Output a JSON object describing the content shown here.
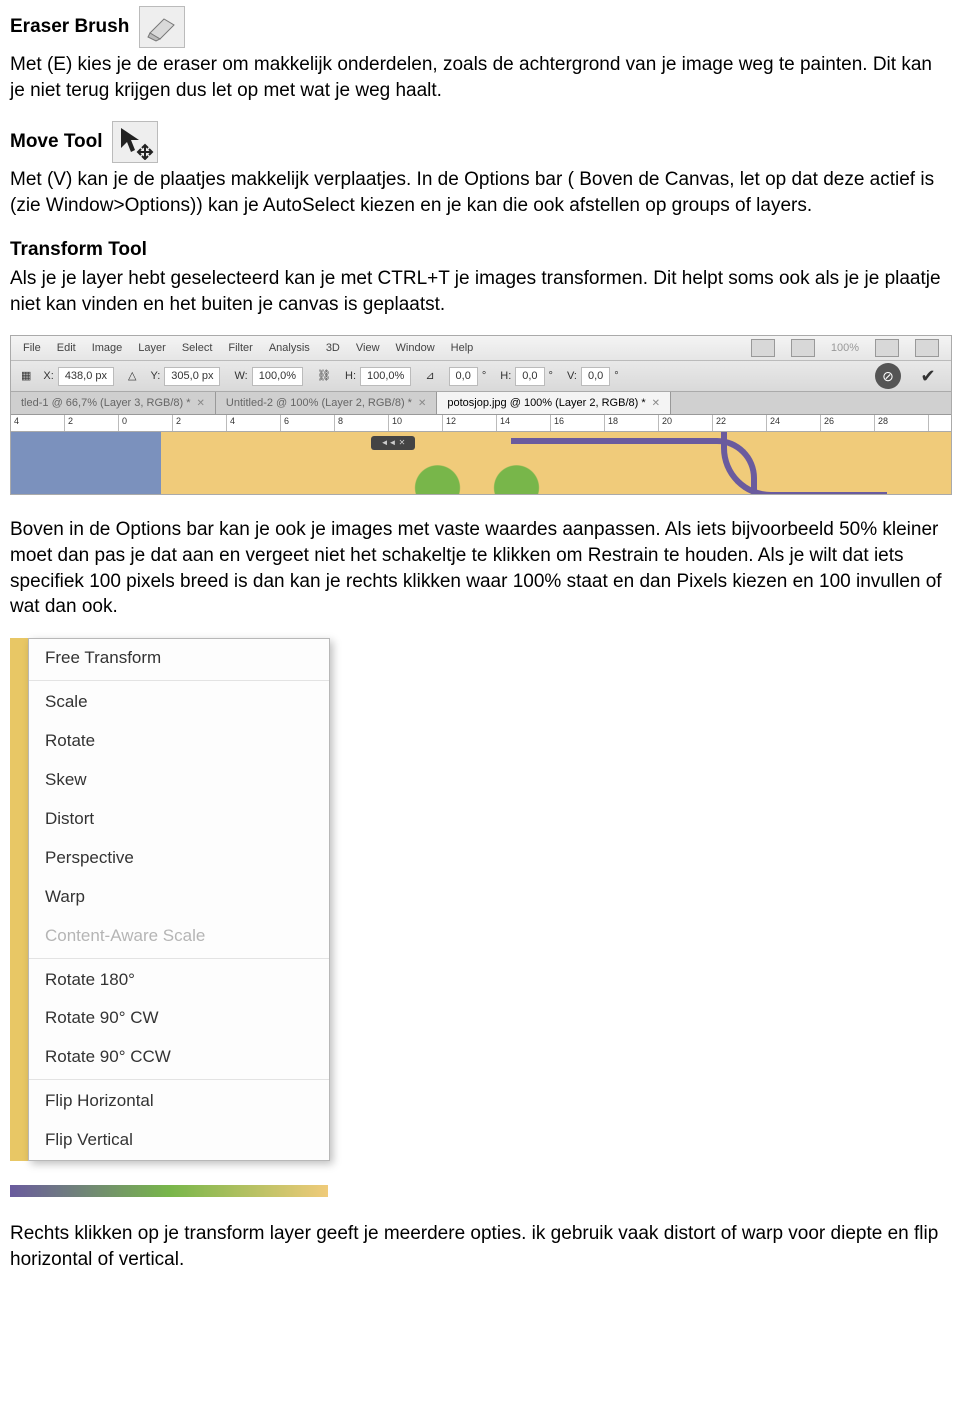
{
  "eraser": {
    "title": "Eraser Brush",
    "body": "Met (E) kies je de eraser om makkelijk onderdelen, zoals de achtergrond van je image weg te painten. Dit kan je niet terug krijgen dus let op met wat je weg haalt."
  },
  "move": {
    "title": "Move Tool",
    "body": "Met (V) kan je de plaatjes makkelijk verplaatjes. In de Options bar ( Boven de Canvas, let op dat deze actief is (zie Window>Options)) kan je AutoSelect kiezen en je kan die ook afstellen op groups of layers."
  },
  "transform": {
    "title": "Transform Tool",
    "body": "Als je je layer hebt geselecteerd kan je met CTRL+T je images transformen. Dit helpt soms ook als je je plaatje niet kan vinden en het buiten je canvas is geplaatst."
  },
  "ps": {
    "menu": [
      "File",
      "Edit",
      "Image",
      "Layer",
      "Select",
      "Filter",
      "Analysis",
      "3D",
      "View",
      "Window",
      "Help"
    ],
    "zoom": "100%",
    "opts": {
      "x_label": "X:",
      "x": "438,0 px",
      "y_label": "Y:",
      "y": "305,0 px",
      "w_label": "W:",
      "w": "100,0%",
      "h_label": "H:",
      "h": "100,0%",
      "rot_label": "",
      "rot": "0,0",
      "rot_deg": "°",
      "hskew_label": "H:",
      "hskew": "0,0",
      "hskew_deg": "°",
      "vskew_label": "V:",
      "vskew": "0,0",
      "vskew_deg": "°"
    },
    "tabs": [
      {
        "label": "tled-1 @ 66,7% (Layer 3, RGB/8) *"
      },
      {
        "label": "Untitled-2 @ 100% (Layer 2, RGB/8) *"
      },
      {
        "label": "potosjop.jpg @ 100% (Layer 2, RGB/8) *",
        "active": true
      }
    ],
    "ruler": [
      "4",
      "2",
      "0",
      "2",
      "4",
      "6",
      "8",
      "10",
      "12",
      "14",
      "16",
      "18",
      "20",
      "22",
      "24",
      "26",
      "28"
    ]
  },
  "after_ps": "Boven in de Options bar kan je ook je images met vaste waardes aanpassen. Als iets bijvoorbeeld 50% kleiner moet dan pas je dat aan en vergeet niet het schakeltje te klikken om Restrain te houden. Als je wilt dat iets specifiek 100 pixels breed is dan kan je rechts klikken waar 100% staat en dan Pixels kiezen en 100 invullen of wat dan ook.",
  "ctx": {
    "items": [
      {
        "label": "Free Transform",
        "disabled": false,
        "sep_after": true
      },
      {
        "label": "Scale"
      },
      {
        "label": "Rotate"
      },
      {
        "label": "Skew"
      },
      {
        "label": "Distort"
      },
      {
        "label": "Perspective"
      },
      {
        "label": "Warp"
      },
      {
        "label": "Content-Aware Scale",
        "disabled": true,
        "sep_after": true
      },
      {
        "label": "Rotate 180°"
      },
      {
        "label": "Rotate 90° CW"
      },
      {
        "label": "Rotate 90° CCW",
        "sep_after": true
      },
      {
        "label": "Flip Horizontal"
      },
      {
        "label": "Flip Vertical"
      }
    ]
  },
  "closing": "Rechts klikken op je transform layer geeft je meerdere opties. ik gebruik vaak distort of warp voor diepte en flip horizontal of vertical."
}
